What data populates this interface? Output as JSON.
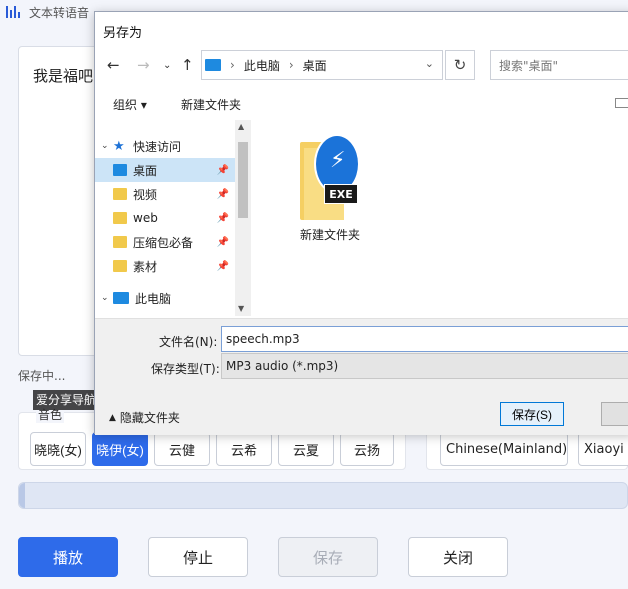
{
  "app": {
    "title": "文本转语音",
    "text_content": "我是福吧",
    "status": "保存中...",
    "watermark": "爱分享导航 ifxdh.com",
    "voice_group_label": "音色",
    "voices": [
      "晓晓(女)",
      "晓伊(女)",
      "云健",
      "云希",
      "云夏",
      "云扬"
    ],
    "selected_voice_index": 1,
    "language": "Chinese(Mainland)",
    "voice_name": "Xiaoyi",
    "progress_percent": 1,
    "buttons": {
      "play": "播放",
      "stop": "停止",
      "save": "保存",
      "close": "关闭"
    },
    "colors": {
      "accent": "#2e6bea"
    }
  },
  "dialog": {
    "title": "另存为",
    "breadcrumb": [
      "此电脑",
      "桌面"
    ],
    "search_placeholder": "搜索\"桌面\"",
    "toolbar": {
      "organize": "组织",
      "new_folder": "新建文件夹"
    },
    "tree": {
      "quick_access": "快速访问",
      "items": [
        "桌面",
        "视频",
        "web",
        "压缩包必备",
        "素材"
      ],
      "this_pc": "此电脑"
    },
    "files": [
      {
        "name": "新建文件夹",
        "icon": "exe-folder-icon"
      }
    ],
    "filename_label": "文件名(N):",
    "filename_value": "speech.mp3",
    "filetype_label": "保存类型(T):",
    "filetype_value": "MP3 audio (*.mp3)",
    "hide_folders": "隐藏文件夹",
    "save_button": "保存(S)"
  }
}
